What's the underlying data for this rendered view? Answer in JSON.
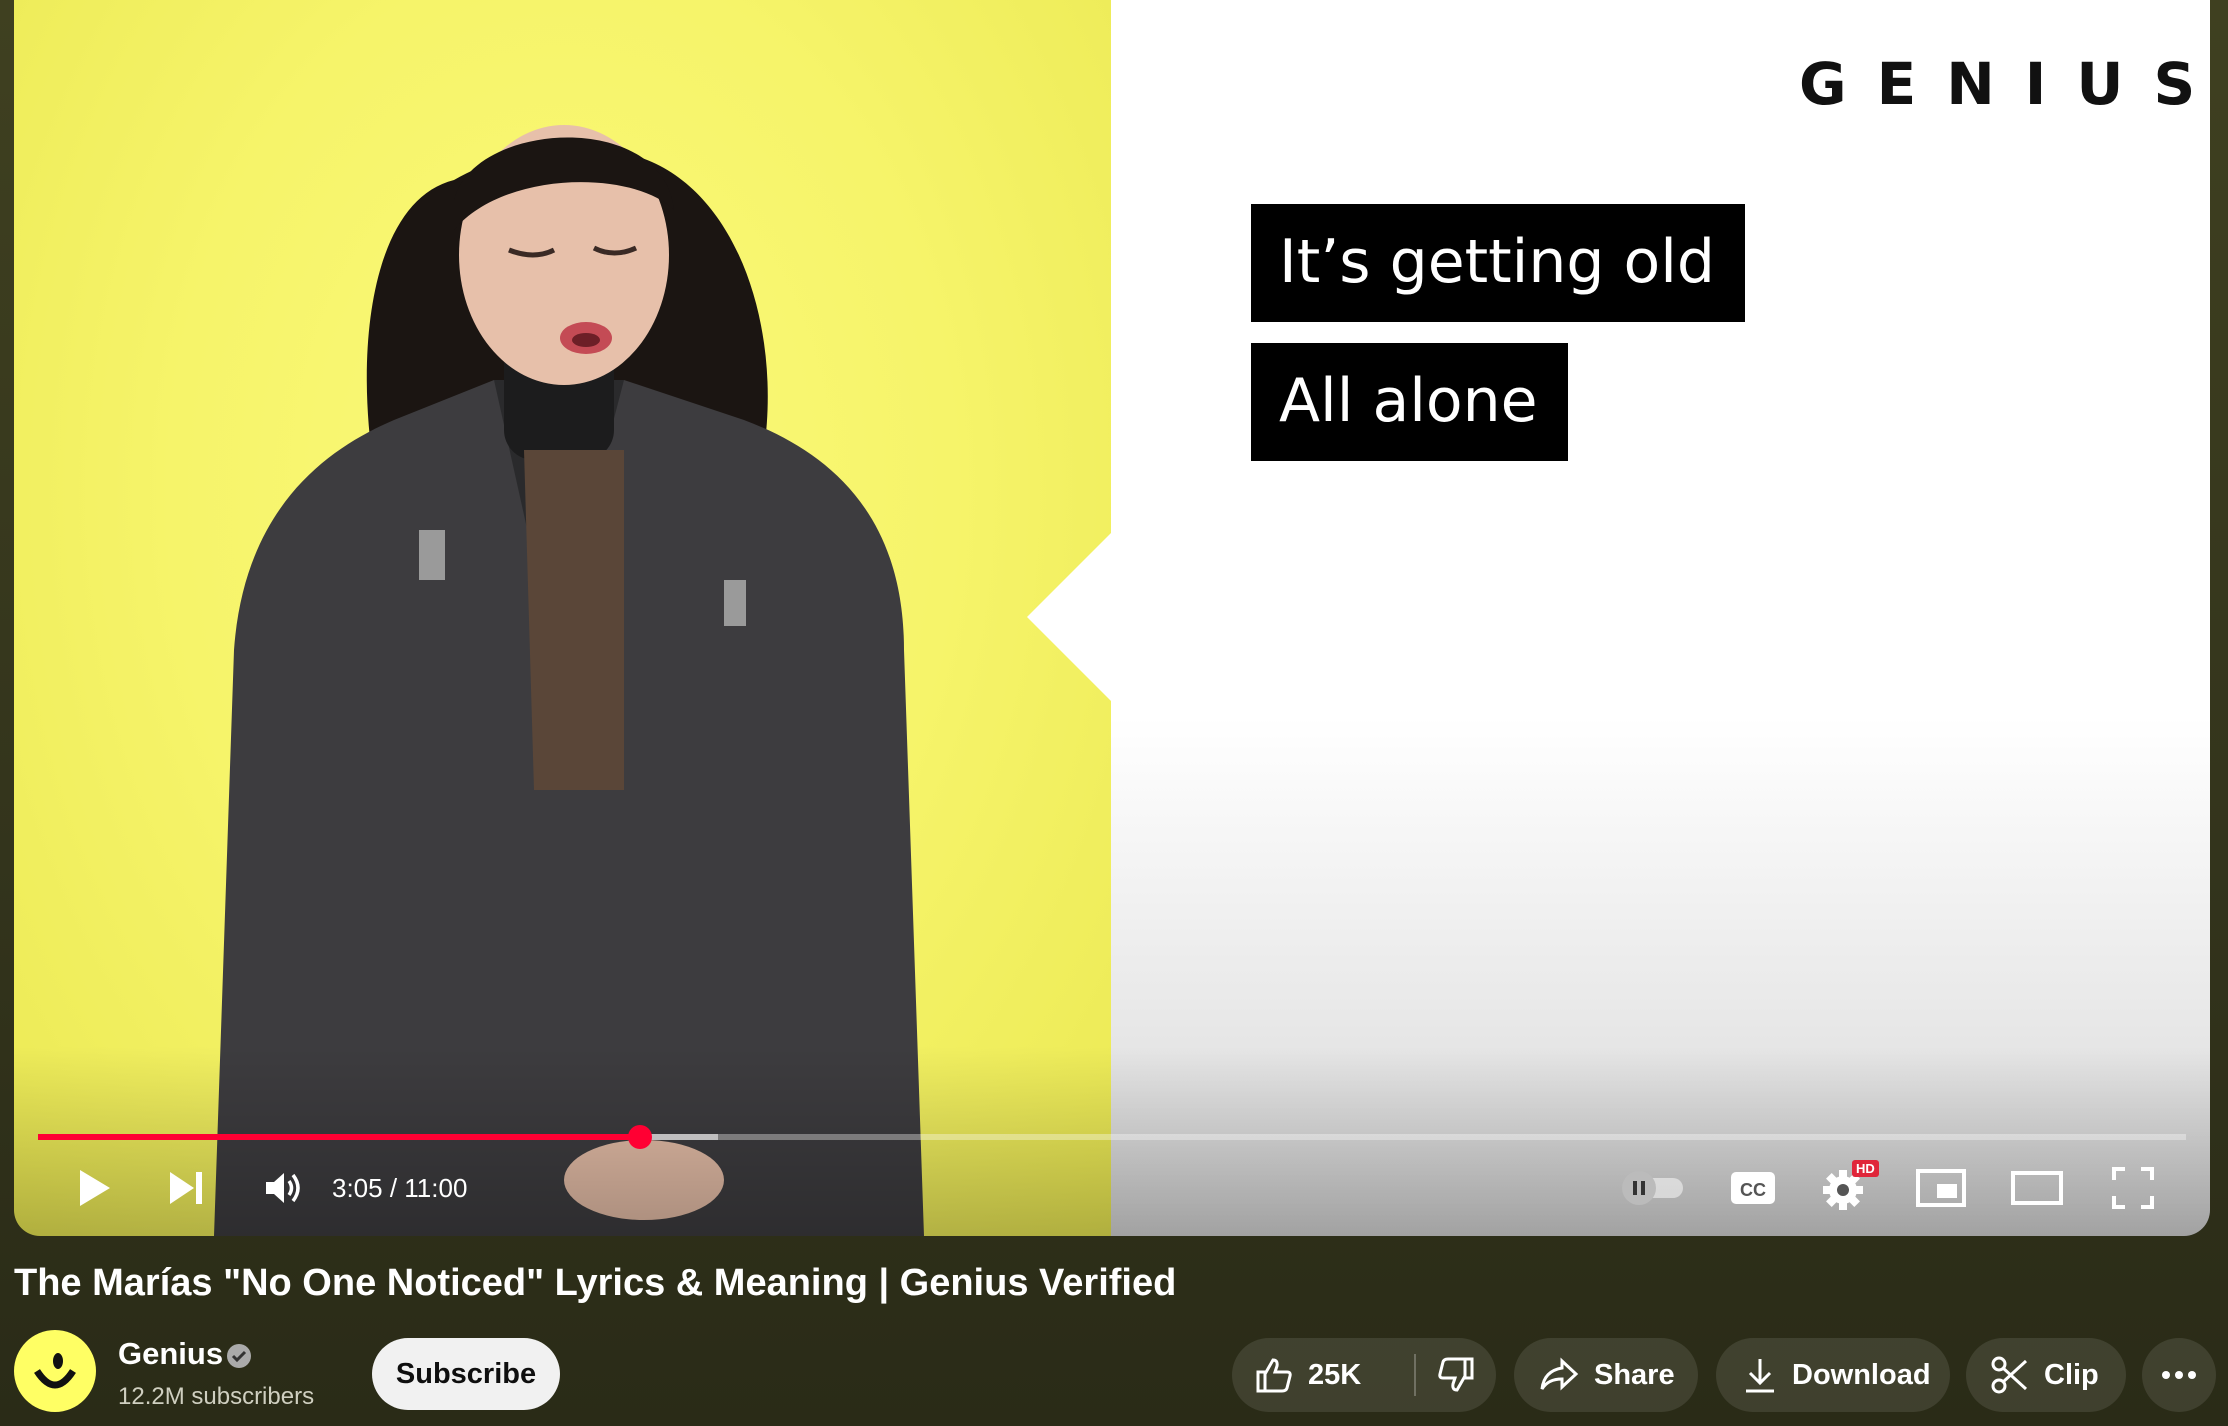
{
  "video": {
    "lyrics": [
      "It’s getting old",
      "All alone"
    ],
    "logo_text": "GENIUS",
    "progress": {
      "current": "3:05",
      "duration": "11:00",
      "played_fraction": 0.2803,
      "buffered_fraction": 0.3168
    },
    "time_display": "3:05 / 11:00",
    "settings_badge": "HD"
  },
  "meta": {
    "title": "The Marías \"No One Noticed\" Lyrics & Meaning | Genius Verified",
    "channel": "Genius",
    "subscribers": "12.2M subscribers",
    "subscribe_label": "Subscribe"
  },
  "actions": {
    "likes": "25K",
    "share": "Share",
    "download": "Download",
    "clip": "Clip"
  },
  "colors": {
    "progress": "#ff0033",
    "yellow_bg": "#f6f46a"
  }
}
